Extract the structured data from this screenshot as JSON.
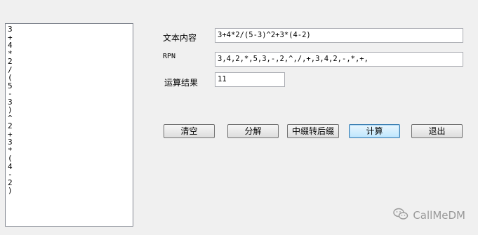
{
  "tokens_list": [
    "3",
    "+",
    "4",
    "*",
    "2",
    "/",
    "(",
    "5",
    "-",
    "3",
    ")",
    "^",
    "2",
    "+",
    "3",
    "*",
    "(",
    "4",
    "-",
    "2",
    ")"
  ],
  "form": {
    "text_label": "文本内容",
    "text_value": "3+4*2/(5-3)^2+3*(4-2)",
    "rpn_label": "RPN",
    "rpn_value": "3,4,2,*,5,3,-,2,^,/,+,3,4,2,-,*,+,",
    "result_label": "运算结果",
    "result_value": "11"
  },
  "buttons": {
    "clear": "清空",
    "split": "分解",
    "infix_to_postfix": "中缀转后缀",
    "calculate": "计算",
    "exit": "退出"
  },
  "watermark": {
    "text": "CallMeDM",
    "icon": "wechat-icon"
  }
}
